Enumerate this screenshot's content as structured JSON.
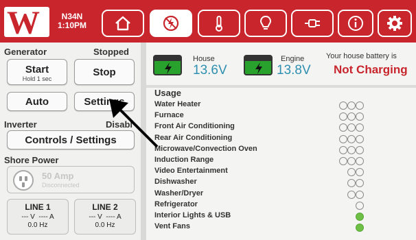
{
  "header": {
    "logo": "W",
    "unit": "N34N",
    "time": "1:10PM",
    "nav": [
      {
        "icon": "home-icon",
        "active": false
      },
      {
        "icon": "generator-icon",
        "active": true
      },
      {
        "icon": "thermometer-icon",
        "active": false
      },
      {
        "icon": "lightbulb-icon",
        "active": false
      },
      {
        "icon": "plug-icon",
        "active": false
      },
      {
        "icon": "info-icon",
        "active": false
      },
      {
        "icon": "gear-icon",
        "active": false
      }
    ]
  },
  "generator": {
    "label": "Generator",
    "status": "Stopped",
    "start_label": "Start",
    "start_hint": "Hold 1 sec",
    "stop_label": "Stop",
    "auto_label": "Auto",
    "settings_label": "Settings"
  },
  "inverter": {
    "label": "Inverter",
    "status": "Disabl",
    "controls_label": "Controls / Settings"
  },
  "shore": {
    "label": "Shore Power",
    "amp": "50 Amp",
    "status": "Disconnected",
    "lines": [
      {
        "title": "LINE 1",
        "volts": "--- V",
        "amps": "---- A",
        "hz": "0.0 Hz"
      },
      {
        "title": "LINE 2",
        "volts": "--- V",
        "amps": "---- A",
        "hz": "0.0 Hz"
      }
    ]
  },
  "batteries": {
    "house_label": "House",
    "house_value": "13.6V",
    "engine_label": "Engine",
    "engine_value": "13.8V",
    "status_title": "Your house battery is",
    "status_value": "Not Charging"
  },
  "colors": {
    "brand_red": "#c8252c",
    "battery_green": "#28a12d",
    "voltage_blue": "#2e8fb0",
    "usage_on": "#6dbf45"
  },
  "usage": {
    "title": "Usage",
    "items": [
      {
        "label": "Water Heater",
        "slots": 3,
        "on": 0
      },
      {
        "label": "Furnace",
        "slots": 3,
        "on": 0
      },
      {
        "label": "Front Air Conditioning",
        "slots": 3,
        "on": 0
      },
      {
        "label": "Rear Air Conditioning",
        "slots": 3,
        "on": 0
      },
      {
        "label": "Microwave/Convection Oven",
        "slots": 3,
        "on": 0
      },
      {
        "label": "Induction Range",
        "slots": 3,
        "on": 0
      },
      {
        "label": "Video Entertainment",
        "slots": 2,
        "on": 0
      },
      {
        "label": "Dishwasher",
        "slots": 2,
        "on": 0
      },
      {
        "label": "Washer/Dryer",
        "slots": 2,
        "on": 0
      },
      {
        "label": "Refrigerator",
        "slots": 1,
        "on": 0
      },
      {
        "label": "Interior Lights & USB",
        "slots": 1,
        "on": 1
      },
      {
        "label": "Vent Fans",
        "slots": 1,
        "on": 1
      }
    ]
  }
}
